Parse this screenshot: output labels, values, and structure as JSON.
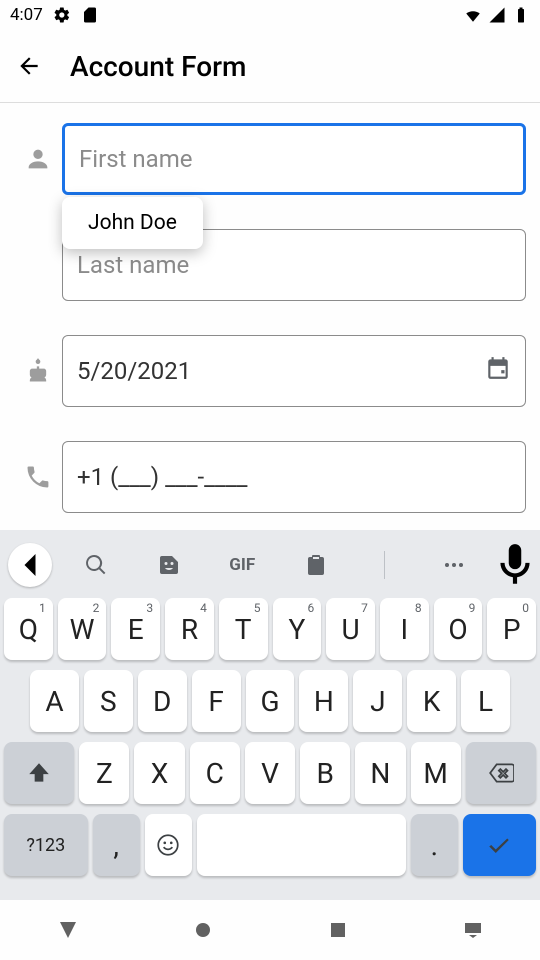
{
  "status": {
    "time": "4:07"
  },
  "appbar": {
    "title": "Account Form"
  },
  "form": {
    "first_name": {
      "placeholder": "First name",
      "value": ""
    },
    "last_name": {
      "placeholder": "Last name",
      "value": ""
    },
    "birthdate": {
      "value": "5/20/2021"
    },
    "phone": {
      "value": "+1 (___) ___-____"
    }
  },
  "autofill_suggestion": "John Doe",
  "keyboard": {
    "gif_label": "GIF",
    "rows": {
      "r1": [
        {
          "m": "Q",
          "s": "1"
        },
        {
          "m": "W",
          "s": "2"
        },
        {
          "m": "E",
          "s": "3"
        },
        {
          "m": "R",
          "s": "4"
        },
        {
          "m": "T",
          "s": "5"
        },
        {
          "m": "Y",
          "s": "6"
        },
        {
          "m": "U",
          "s": "7"
        },
        {
          "m": "I",
          "s": "8"
        },
        {
          "m": "O",
          "s": "9"
        },
        {
          "m": "P",
          "s": "0"
        }
      ],
      "r2": [
        {
          "m": "A"
        },
        {
          "m": "S"
        },
        {
          "m": "D"
        },
        {
          "m": "F"
        },
        {
          "m": "G"
        },
        {
          "m": "H"
        },
        {
          "m": "J"
        },
        {
          "m": "K"
        },
        {
          "m": "L"
        }
      ],
      "r3": [
        {
          "m": "Z"
        },
        {
          "m": "X"
        },
        {
          "m": "C"
        },
        {
          "m": "V"
        },
        {
          "m": "B"
        },
        {
          "m": "N"
        },
        {
          "m": "M"
        }
      ]
    },
    "sym_label": "?123",
    "comma": ",",
    "dot": "."
  }
}
